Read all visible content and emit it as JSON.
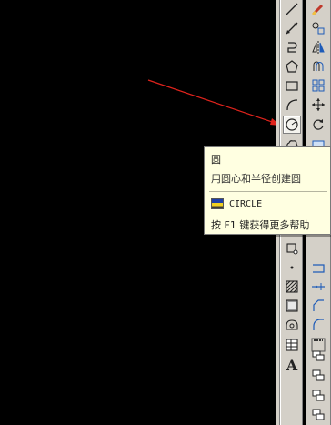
{
  "draw_toolbar": {
    "tools": [
      {
        "name": "line-icon"
      },
      {
        "name": "construction-line-icon"
      },
      {
        "name": "polyline-icon"
      },
      {
        "name": "polygon-icon"
      },
      {
        "name": "rectangle-icon"
      },
      {
        "name": "arc-icon"
      },
      {
        "name": "circle-icon",
        "active": true
      },
      {
        "name": "revision-cloud-icon"
      },
      {
        "name": "block-icon"
      },
      {
        "name": "point-icon"
      },
      {
        "name": "hatch-icon"
      },
      {
        "name": "gradient-icon"
      },
      {
        "name": "region-icon"
      },
      {
        "name": "table-icon"
      },
      {
        "name": "multiline-text-icon",
        "glyph": "A"
      }
    ]
  },
  "modify_toolbar": {
    "tools": [
      {
        "name": "erase-icon"
      },
      {
        "name": "copy-icon"
      },
      {
        "name": "mirror-icon"
      },
      {
        "name": "offset-icon"
      },
      {
        "name": "array-icon"
      },
      {
        "name": "move-icon"
      },
      {
        "name": "rotate-icon"
      },
      {
        "name": "scale-icon"
      },
      {
        "name": "break-icon"
      },
      {
        "name": "extend-icon"
      },
      {
        "name": "chamfer-icon"
      },
      {
        "name": "fillet-icon"
      },
      {
        "name": "explode-icon"
      },
      {
        "name": "draworder-icon"
      }
    ]
  },
  "tooltip": {
    "title": "圆",
    "description": "用圆心和半径创建圆",
    "command": "CIRCLE",
    "help": "按 F1 键获得更多帮助"
  },
  "colors": {
    "canvas": "#000000",
    "toolbar": "#d4d0c8",
    "tooltip_bg": "#ffffe1",
    "arrow": "#e0231c"
  }
}
